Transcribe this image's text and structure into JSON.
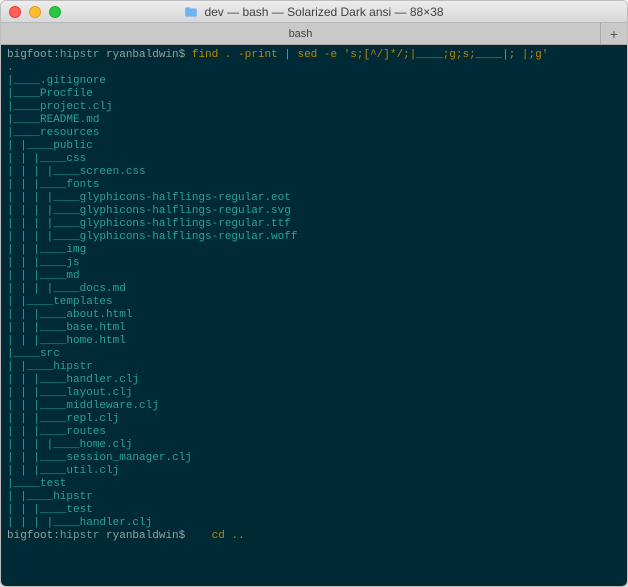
{
  "titlebar": {
    "title": "dev — bash — Solarized Dark ansi — 88×38"
  },
  "tabs": {
    "active": "bash",
    "new_tab_glyph": "+"
  },
  "prompt1": {
    "host": "bigfoot:",
    "dir": "hipstr ",
    "user": "ryanbaldwin$ ",
    "cmd": "find . -print | sed -e 's;[^/]*/;|____;g;s;____|; |;g'"
  },
  "tree_lines": [
    ".",
    "|____.gitignore",
    "|____Procfile",
    "|____project.clj",
    "|____README.md",
    "|____resources",
    "| |____public",
    "| | |____css",
    "| | | |____screen.css",
    "| | |____fonts",
    "| | | |____glyphicons-halflings-regular.eot",
    "| | | |____glyphicons-halflings-regular.svg",
    "| | | |____glyphicons-halflings-regular.ttf",
    "| | | |____glyphicons-halflings-regular.woff",
    "| | |____img",
    "| | |____js",
    "| | |____md",
    "| | | |____docs.md",
    "| |____templates",
    "| | |____about.html",
    "| | |____base.html",
    "| | |____home.html",
    "|____src",
    "| |____hipstr",
    "| | |____handler.clj",
    "| | |____layout.clj",
    "| | |____middleware.clj",
    "| | |____repl.clj",
    "| | |____routes",
    "| | | |____home.clj",
    "| | |____session_manager.clj",
    "| | |____util.clj",
    "|____test",
    "| |____hipstr",
    "| | |____test",
    "| | | |____handler.clj"
  ],
  "prompt2": {
    "host": "bigfoot:",
    "dir": "hipstr ",
    "user": "ryanbaldwin$ ",
    "cmd": "   cd .."
  }
}
